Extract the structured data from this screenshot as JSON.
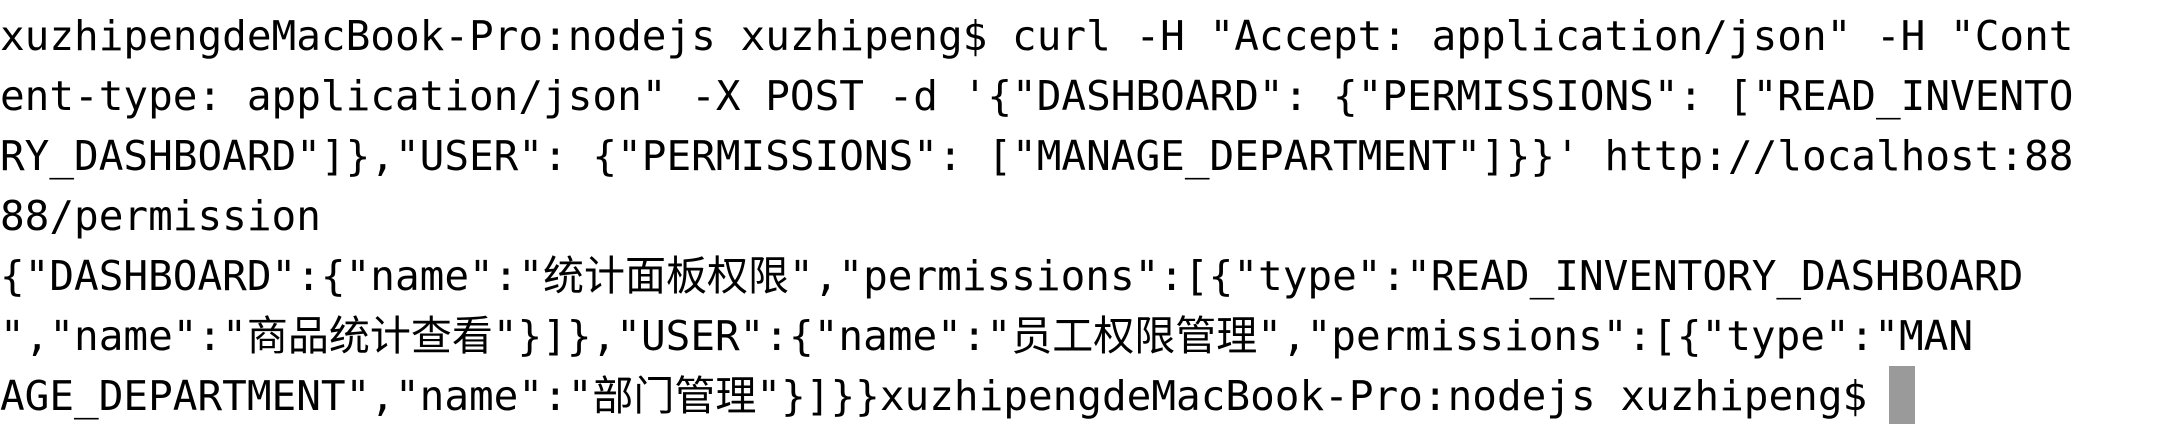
{
  "terminal": {
    "lines": [
      "xuzhipengdeMacBook-Pro:nodejs xuzhipeng$ curl -H \"Accept: application/json\" -H \"Cont",
      "ent-type: application/json\" -X POST -d '{\"DASHBOARD\": {\"PERMISSIONS\": [\"READ_INVENTO",
      "RY_DASHBOARD\"]},\"USER\": {\"PERMISSIONS\": [\"MANAGE_DEPARTMENT\"]}}' http://localhost:88",
      "88/permission",
      "{\"DASHBOARD\":{\"name\":\"统计面板权限\",\"permissions\":[{\"type\":\"READ_INVENTORY_DASHBOARD",
      "\",\"name\":\"商品统计查看\"}]},\"USER\":{\"name\":\"员工权限管理\",\"permissions\":[{\"type\":\"MAN",
      "AGE_DEPARTMENT\",\"name\":\"部门管理\"}]}}xuzhipengdeMacBook-Pro:nodejs xuzhipeng$"
    ]
  }
}
